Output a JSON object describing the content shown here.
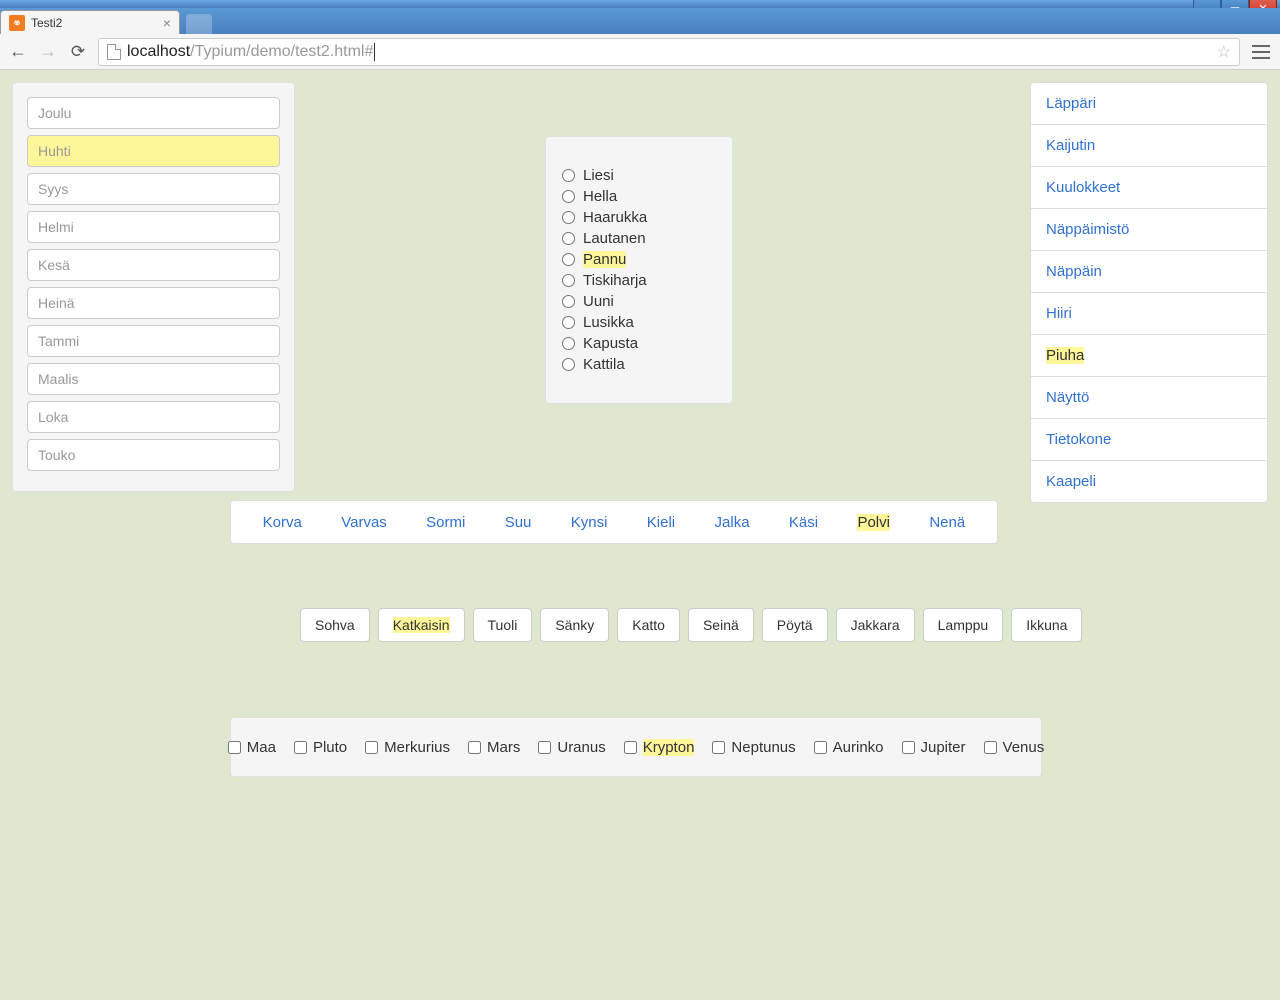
{
  "browser": {
    "tab_title": "Testi2",
    "url_host": "localhost",
    "url_path": "/Typium/demo/test2.html#"
  },
  "left_inputs": [
    {
      "placeholder": "Joulu",
      "highlight": false
    },
    {
      "placeholder": "Huhti",
      "highlight": true
    },
    {
      "placeholder": "Syys",
      "highlight": false
    },
    {
      "placeholder": "Helmi",
      "highlight": false
    },
    {
      "placeholder": "Kesä",
      "highlight": false
    },
    {
      "placeholder": "Heinä",
      "highlight": false
    },
    {
      "placeholder": "Tammi",
      "highlight": false
    },
    {
      "placeholder": "Maalis",
      "highlight": false
    },
    {
      "placeholder": "Loka",
      "highlight": false
    },
    {
      "placeholder": "Touko",
      "highlight": false
    }
  ],
  "radios": [
    {
      "label": "Liesi",
      "highlight": false
    },
    {
      "label": "Hella",
      "highlight": false
    },
    {
      "label": "Haarukka",
      "highlight": false
    },
    {
      "label": "Lautanen",
      "highlight": false
    },
    {
      "label": "Pannu",
      "highlight": true
    },
    {
      "label": "Tiskiharja",
      "highlight": false
    },
    {
      "label": "Uuni",
      "highlight": false
    },
    {
      "label": "Lusikka",
      "highlight": false
    },
    {
      "label": "Kapusta",
      "highlight": false
    },
    {
      "label": "Kattila",
      "highlight": false
    }
  ],
  "right_links": [
    {
      "label": "Läppäri",
      "highlight": false
    },
    {
      "label": "Kaijutin",
      "highlight": false
    },
    {
      "label": "Kuulokkeet",
      "highlight": false
    },
    {
      "label": "Näppäimistö",
      "highlight": false
    },
    {
      "label": "Näppäin",
      "highlight": false
    },
    {
      "label": "Hiiri",
      "highlight": false
    },
    {
      "label": "Piuha",
      "highlight": true
    },
    {
      "label": "Näyttö",
      "highlight": false
    },
    {
      "label": "Tietokone",
      "highlight": false
    },
    {
      "label": "Kaapeli",
      "highlight": false
    }
  ],
  "nav_links": [
    {
      "label": "Korva",
      "highlight": false
    },
    {
      "label": "Varvas",
      "highlight": false
    },
    {
      "label": "Sormi",
      "highlight": false
    },
    {
      "label": "Suu",
      "highlight": false
    },
    {
      "label": "Kynsi",
      "highlight": false
    },
    {
      "label": "Kieli",
      "highlight": false
    },
    {
      "label": "Jalka",
      "highlight": false
    },
    {
      "label": "Käsi",
      "highlight": false
    },
    {
      "label": "Polvi",
      "highlight": true
    },
    {
      "label": "Nenä",
      "highlight": false
    }
  ],
  "buttons": [
    {
      "label": "Sohva",
      "highlight": false
    },
    {
      "label": "Katkaisin",
      "highlight": true
    },
    {
      "label": "Tuoli",
      "highlight": false
    },
    {
      "label": "Sänky",
      "highlight": false
    },
    {
      "label": "Katto",
      "highlight": false
    },
    {
      "label": "Seinä",
      "highlight": false
    },
    {
      "label": "Pöytä",
      "highlight": false
    },
    {
      "label": "Jakkara",
      "highlight": false
    },
    {
      "label": "Lamppu",
      "highlight": false
    },
    {
      "label": "Ikkuna",
      "highlight": false
    }
  ],
  "checkboxes": [
    {
      "label": "Maa",
      "highlight": false
    },
    {
      "label": "Pluto",
      "highlight": false
    },
    {
      "label": "Merkurius",
      "highlight": false
    },
    {
      "label": "Mars",
      "highlight": false
    },
    {
      "label": "Uranus",
      "highlight": false
    },
    {
      "label": "Krypton",
      "highlight": true
    },
    {
      "label": "Neptunus",
      "highlight": false
    },
    {
      "label": "Aurinko",
      "highlight": false
    },
    {
      "label": "Jupiter",
      "highlight": false
    },
    {
      "label": "Venus",
      "highlight": false
    }
  ]
}
